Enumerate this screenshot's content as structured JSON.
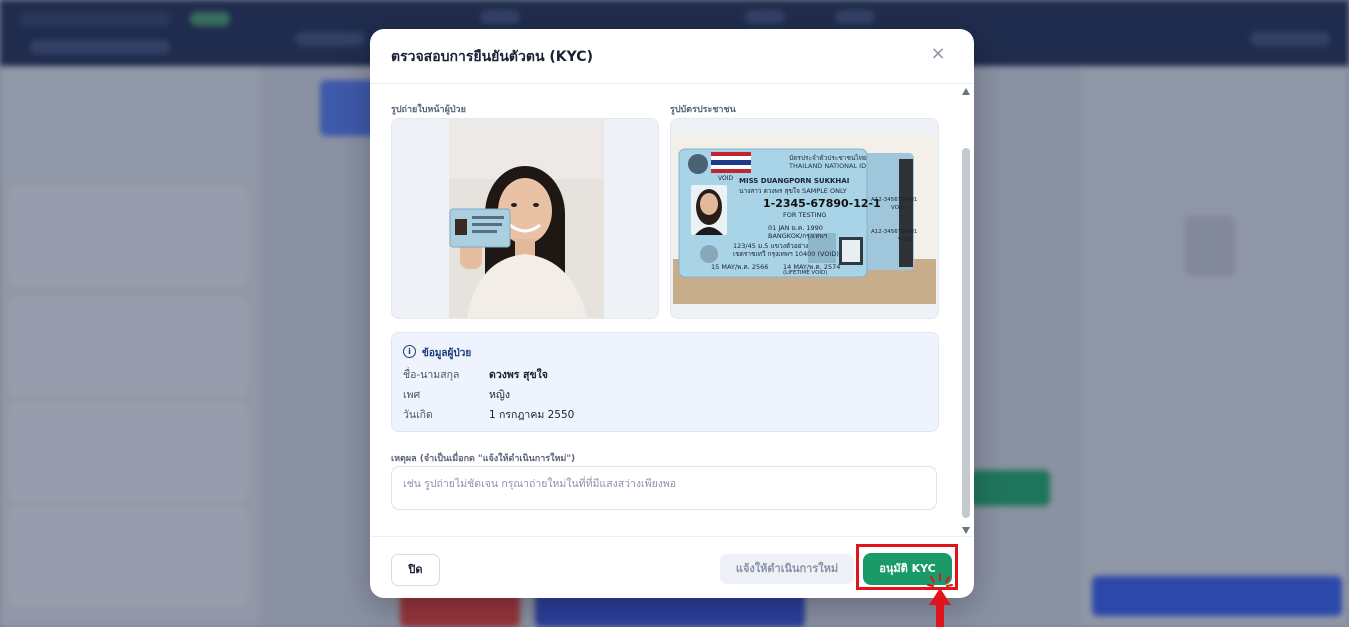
{
  "modal": {
    "title": "ตรวจสอบการยืนยันตัวตน (KYC)",
    "close_glyph": "×",
    "selfie_label": "รูปถ่ายใบหน้าผู้ป่วย",
    "idcard_label": "รูปบัตรประชาชน",
    "idcard": {
      "header_th": "บัตรประจำตัวประชาชนไทย",
      "header_en": "THAILAND NATIONAL ID",
      "name_en": "MISS DUANGPORN SUKKHAI",
      "name_th": "นางสาว ดวงพร สุขใจ",
      "sample": "SAMPLE ONLY",
      "id_number": "1-2345-67890-12-1",
      "testing": "FOR TESTING",
      "dob": "01 JAN ม.ค. 1990",
      "place": "BANGKOK/กรุงเทพฯ",
      "address": "123/45 ม.5 แขวงตัวอย่าง",
      "address2": "เขตราชเทวี กรุงเทพฯ 10400 (VOID)",
      "issue": "15 MAY/พ.ค. 2566",
      "expiry": "14 MAY/พ.ค. 2574",
      "lifetime": "(LIFETIME VOID)",
      "void": "VOID",
      "laser1": "A12-3456789-01",
      "laser2": "A12-3456789-01"
    },
    "patient_info": {
      "title": "ข้อมูลผู้ป่วย",
      "icon": "i",
      "rows": [
        {
          "label": "ชื่อ-นามสกุล",
          "value": "ดวงพร สุขใจ"
        },
        {
          "label": "เพศ",
          "value": "หญิง"
        },
        {
          "label": "วันเกิด",
          "value": "1 กรกฎาคม 2550"
        }
      ]
    },
    "reason": {
      "label": "เหตุผล (จำเป็นเมื่อกด \"แจ้งให้ดำเนินการใหม่\")",
      "value": "",
      "placeholder": "เช่น รูปถ่ายไม่ชัดเจน กรุณาถ่ายใหม่ในที่ที่มีแสงสว่างเพียงพอ"
    },
    "footer": {
      "close_label": "ปิด",
      "resubmit_label": "แจ้งให้ดำเนินการใหม่",
      "approve_label": "อนุมัติ KYC"
    }
  },
  "colors": {
    "approve": "#1b9a69",
    "highlight": "#e0141a",
    "info_bg": "#eef3fd"
  }
}
